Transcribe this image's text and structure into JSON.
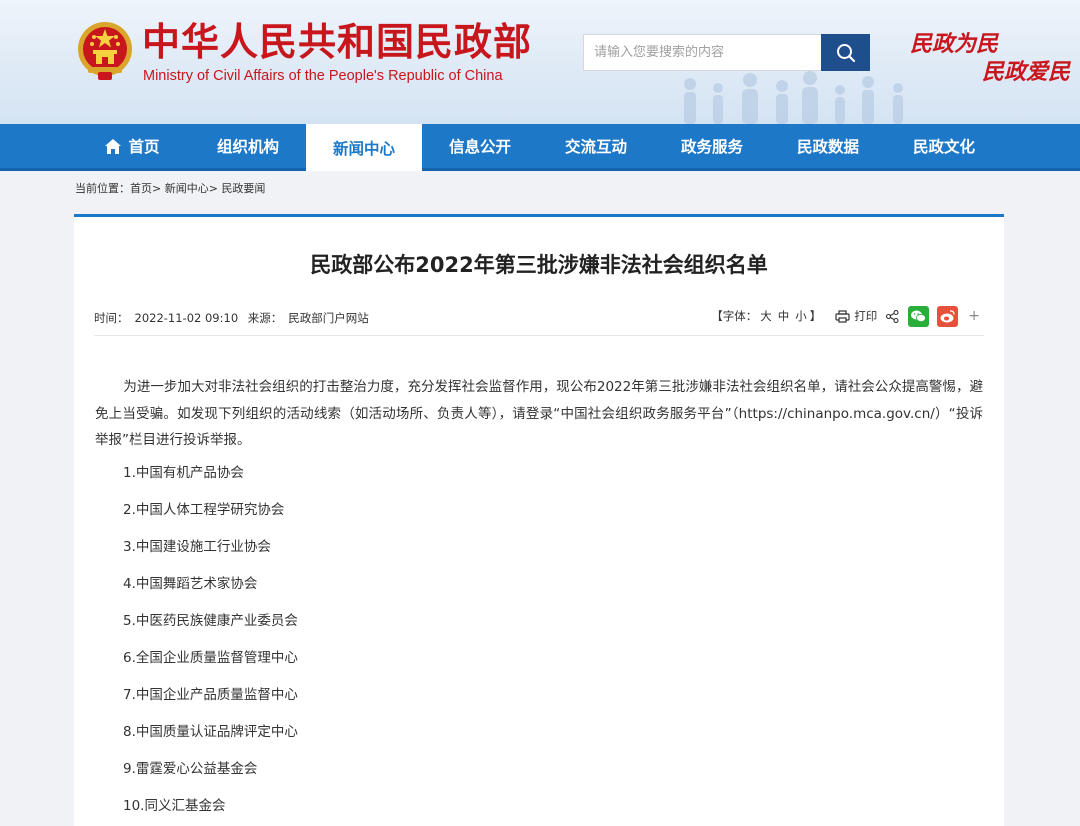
{
  "header": {
    "title": "中华人民共和国民政部",
    "subtitle": "Ministry of Civil Affairs of the People's Republic of China",
    "search_placeholder": "请输入您要搜索的内容",
    "slogan_line1": "民政为民",
    "slogan_line2": "民政爱民",
    "brand_color": "#c8161d"
  },
  "nav": {
    "items": [
      {
        "label": "首页"
      },
      {
        "label": "组织机构"
      },
      {
        "label": "新闻中心"
      },
      {
        "label": "信息公开"
      },
      {
        "label": "交流互动"
      },
      {
        "label": "政务服务"
      },
      {
        "label": "民政数据"
      },
      {
        "label": "民政文化"
      }
    ],
    "active": "新闻中心",
    "color": "#1d78c8"
  },
  "breadcrumb": {
    "prefix": "当前位置：",
    "items": [
      "首页",
      "新闻中心",
      "民政要闻"
    ],
    "separator": ">"
  },
  "article": {
    "title": "民政部公布2022年第三批涉嫌非法社会组织名单",
    "time_label": "时间：",
    "time": "2022-11-02 09:10",
    "source_label": "来源：",
    "source": "民政部门户网站",
    "font_label_open": "【字体：",
    "font_large": "大",
    "font_medium": "中",
    "font_small": "小",
    "font_label_close": "】",
    "print_label": "打印",
    "more_symbol": "+",
    "intro": "为进一步加大对非法社会组织的打击整治力度，充分发挥社会监督作用，现公布2022年第三批涉嫌非法社会组织名单，请社会公众提高警惕，避免上当受骗。如发现下列组织的活动线索（如活动场所、负责人等），请登录“中国社会组织政务服务平台”（https://chinanpo.mca.gov.cn/）“投诉举报”栏目进行投诉举报。",
    "list": [
      "1.中国有机产品协会",
      "2.中国人体工程学研究协会",
      "3.中国建设施工行业协会",
      "4.中国舞蹈艺术家协会",
      "5.中医药民族健康产业委员会",
      "6.全国企业质量监督管理中心",
      "7.中国企业产品质量监督中心",
      "8.中国质量认证品牌评定中心",
      "9.雷霆爱心公益基金会",
      "10.同义汇基金会"
    ]
  }
}
